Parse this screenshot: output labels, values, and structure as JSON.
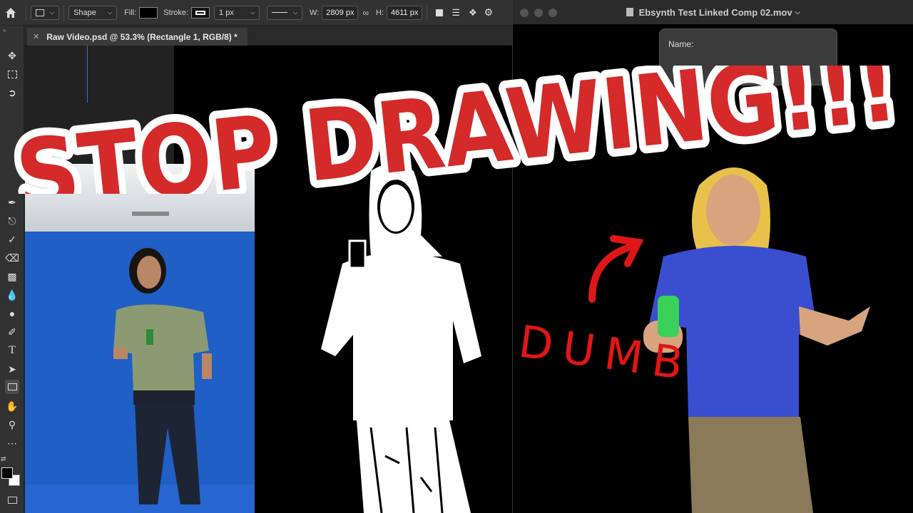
{
  "options_bar": {
    "mode": "Shape",
    "fill_label": "Fill:",
    "stroke_label": "Stroke:",
    "stroke_width": "1 px",
    "width_label": "W:",
    "width_value": "2809 px",
    "height_label": "H:",
    "height_value": "4611 px"
  },
  "document_tab": {
    "title": "Raw Video.psd @ 53.3% (Rectangle 1, RGB/8) *"
  },
  "quicktime": {
    "title": "Ebsynth Test Linked Comp 02.mov",
    "popup_label": "Name:"
  },
  "overlay": {
    "headline": "STOP DRAWING!!!",
    "scribble": "DUMB"
  },
  "colors": {
    "headline_red": "#d42a2a",
    "scribble_red": "#e01616",
    "blue_screen": "#1f5fc6",
    "shirt_blue": "#3a4fcf"
  }
}
